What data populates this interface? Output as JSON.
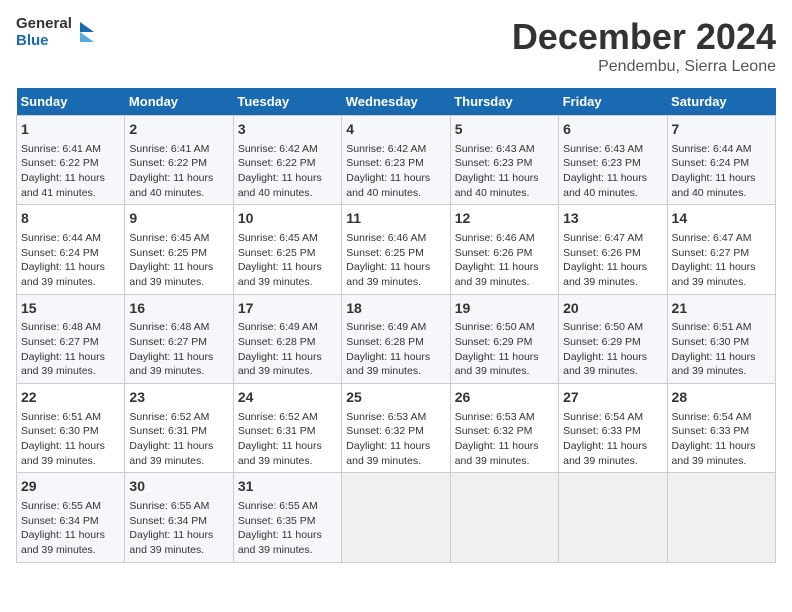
{
  "logo": {
    "text_general": "General",
    "text_blue": "Blue"
  },
  "header": {
    "month": "December 2024",
    "location": "Pendembu, Sierra Leone"
  },
  "days_of_week": [
    "Sunday",
    "Monday",
    "Tuesday",
    "Wednesday",
    "Thursday",
    "Friday",
    "Saturday"
  ],
  "weeks": [
    [
      {
        "day": 1,
        "sunrise": "6:41 AM",
        "sunset": "6:22 PM",
        "daylight": "11 hours and 41 minutes."
      },
      {
        "day": 2,
        "sunrise": "6:41 AM",
        "sunset": "6:22 PM",
        "daylight": "11 hours and 40 minutes."
      },
      {
        "day": 3,
        "sunrise": "6:42 AM",
        "sunset": "6:22 PM",
        "daylight": "11 hours and 40 minutes."
      },
      {
        "day": 4,
        "sunrise": "6:42 AM",
        "sunset": "6:23 PM",
        "daylight": "11 hours and 40 minutes."
      },
      {
        "day": 5,
        "sunrise": "6:43 AM",
        "sunset": "6:23 PM",
        "daylight": "11 hours and 40 minutes."
      },
      {
        "day": 6,
        "sunrise": "6:43 AM",
        "sunset": "6:23 PM",
        "daylight": "11 hours and 40 minutes."
      },
      {
        "day": 7,
        "sunrise": "6:44 AM",
        "sunset": "6:24 PM",
        "daylight": "11 hours and 40 minutes."
      }
    ],
    [
      {
        "day": 8,
        "sunrise": "6:44 AM",
        "sunset": "6:24 PM",
        "daylight": "11 hours and 39 minutes."
      },
      {
        "day": 9,
        "sunrise": "6:45 AM",
        "sunset": "6:25 PM",
        "daylight": "11 hours and 39 minutes."
      },
      {
        "day": 10,
        "sunrise": "6:45 AM",
        "sunset": "6:25 PM",
        "daylight": "11 hours and 39 minutes."
      },
      {
        "day": 11,
        "sunrise": "6:46 AM",
        "sunset": "6:25 PM",
        "daylight": "11 hours and 39 minutes."
      },
      {
        "day": 12,
        "sunrise": "6:46 AM",
        "sunset": "6:26 PM",
        "daylight": "11 hours and 39 minutes."
      },
      {
        "day": 13,
        "sunrise": "6:47 AM",
        "sunset": "6:26 PM",
        "daylight": "11 hours and 39 minutes."
      },
      {
        "day": 14,
        "sunrise": "6:47 AM",
        "sunset": "6:27 PM",
        "daylight": "11 hours and 39 minutes."
      }
    ],
    [
      {
        "day": 15,
        "sunrise": "6:48 AM",
        "sunset": "6:27 PM",
        "daylight": "11 hours and 39 minutes."
      },
      {
        "day": 16,
        "sunrise": "6:48 AM",
        "sunset": "6:27 PM",
        "daylight": "11 hours and 39 minutes."
      },
      {
        "day": 17,
        "sunrise": "6:49 AM",
        "sunset": "6:28 PM",
        "daylight": "11 hours and 39 minutes."
      },
      {
        "day": 18,
        "sunrise": "6:49 AM",
        "sunset": "6:28 PM",
        "daylight": "11 hours and 39 minutes."
      },
      {
        "day": 19,
        "sunrise": "6:50 AM",
        "sunset": "6:29 PM",
        "daylight": "11 hours and 39 minutes."
      },
      {
        "day": 20,
        "sunrise": "6:50 AM",
        "sunset": "6:29 PM",
        "daylight": "11 hours and 39 minutes."
      },
      {
        "day": 21,
        "sunrise": "6:51 AM",
        "sunset": "6:30 PM",
        "daylight": "11 hours and 39 minutes."
      }
    ],
    [
      {
        "day": 22,
        "sunrise": "6:51 AM",
        "sunset": "6:30 PM",
        "daylight": "11 hours and 39 minutes."
      },
      {
        "day": 23,
        "sunrise": "6:52 AM",
        "sunset": "6:31 PM",
        "daylight": "11 hours and 39 minutes."
      },
      {
        "day": 24,
        "sunrise": "6:52 AM",
        "sunset": "6:31 PM",
        "daylight": "11 hours and 39 minutes."
      },
      {
        "day": 25,
        "sunrise": "6:53 AM",
        "sunset": "6:32 PM",
        "daylight": "11 hours and 39 minutes."
      },
      {
        "day": 26,
        "sunrise": "6:53 AM",
        "sunset": "6:32 PM",
        "daylight": "11 hours and 39 minutes."
      },
      {
        "day": 27,
        "sunrise": "6:54 AM",
        "sunset": "6:33 PM",
        "daylight": "11 hours and 39 minutes."
      },
      {
        "day": 28,
        "sunrise": "6:54 AM",
        "sunset": "6:33 PM",
        "daylight": "11 hours and 39 minutes."
      }
    ],
    [
      {
        "day": 29,
        "sunrise": "6:55 AM",
        "sunset": "6:34 PM",
        "daylight": "11 hours and 39 minutes."
      },
      {
        "day": 30,
        "sunrise": "6:55 AM",
        "sunset": "6:34 PM",
        "daylight": "11 hours and 39 minutes."
      },
      {
        "day": 31,
        "sunrise": "6:55 AM",
        "sunset": "6:35 PM",
        "daylight": "11 hours and 39 minutes."
      },
      null,
      null,
      null,
      null
    ]
  ]
}
